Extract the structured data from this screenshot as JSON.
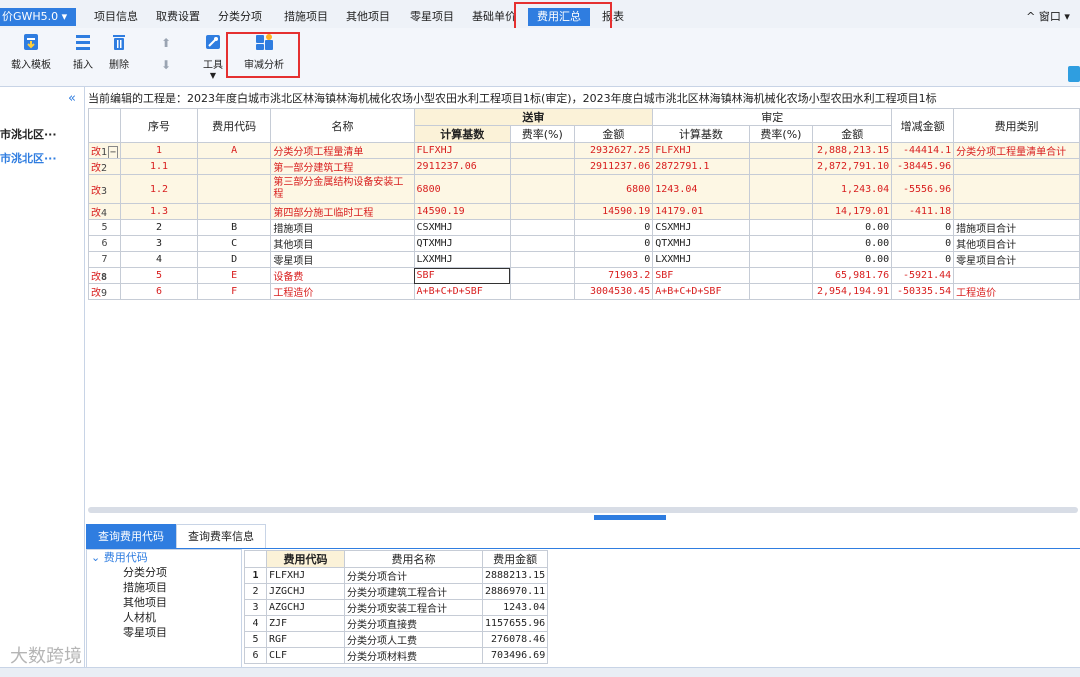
{
  "app": {
    "title": "价GWH5.0"
  },
  "menu": {
    "items": [
      "项目信息",
      "取费设置",
      "分类分项",
      "措施项目",
      "其他项目",
      "零星项目",
      "基础单价",
      "费用汇总",
      "报表"
    ],
    "active": "费用汇总",
    "window_label": "窗口"
  },
  "toolbar": {
    "load_template": "载入模板",
    "insert": "插入",
    "delete": "删除",
    "tools": "工具",
    "audit_analysis": "审减分析"
  },
  "left_panel": {
    "items": [
      "市洮北区···",
      "市洮北区···"
    ]
  },
  "project_info": "当前编辑的工程是：2023年度白城市洮北区林海镇林海机械化农场小型农田水利工程项目1标(审定)，2023年度白城市洮北区林海镇林海机械化农场小型农田水利工程项目1标",
  "grid": {
    "headers": {
      "seq": "序号",
      "code": "费用代码",
      "name": "名称",
      "submit": "送审",
      "approve": "审定",
      "base": "计算基数",
      "rate": "费率(%)",
      "amount": "金额",
      "diff": "增减金额",
      "category": "费用类别"
    },
    "rows": [
      {
        "mark": "改",
        "row": "1",
        "toggle": "−",
        "seq": "1",
        "code": "A",
        "name": "分类分项工程量清单",
        "s_base": "FLFXHJ",
        "s_rate": "",
        "s_amount": "2932627.25",
        "a_base": "FLFXHJ",
        "a_rate": "",
        "a_amount": "2,888,213.15",
        "diff": "-44414.1",
        "category": "分类分项工程量清单合计",
        "red": true
      },
      {
        "mark": "改",
        "row": "2",
        "seq": "1.1",
        "code": "",
        "name": "第一部分建筑工程",
        "s_base": "2911237.06",
        "s_rate": "",
        "s_amount": "2911237.06",
        "a_base": "2872791.1",
        "a_rate": "",
        "a_amount": "2,872,791.10",
        "diff": "-38445.96",
        "category": "",
        "red": true
      },
      {
        "mark": "改",
        "row": "3",
        "seq": "1.2",
        "code": "",
        "name": "第三部分金属结构设备安装工程",
        "s_base": "6800",
        "s_rate": "",
        "s_amount": "6800",
        "a_base": "1243.04",
        "a_rate": "",
        "a_amount": "1,243.04",
        "diff": "-5556.96",
        "category": "",
        "red": true
      },
      {
        "mark": "改",
        "row": "4",
        "seq": "1.3",
        "code": "",
        "name": "第四部分施工临时工程",
        "s_base": "14590.19",
        "s_rate": "",
        "s_amount": "14590.19",
        "a_base": "14179.01",
        "a_rate": "",
        "a_amount": "14,179.01",
        "diff": "-411.18",
        "category": "",
        "red": true
      },
      {
        "mark": "",
        "row": "5",
        "seq": "2",
        "code": "B",
        "name": "措施项目",
        "s_base": "CSXMHJ",
        "s_rate": "",
        "s_amount": "0",
        "a_base": "CSXMHJ",
        "a_rate": "",
        "a_amount": "0.00",
        "diff": "0",
        "category": "措施项目合计",
        "red": false
      },
      {
        "mark": "",
        "row": "6",
        "seq": "3",
        "code": "C",
        "name": "其他项目",
        "s_base": "QTXMHJ",
        "s_rate": "",
        "s_amount": "0",
        "a_base": "QTXMHJ",
        "a_rate": "",
        "a_amount": "0.00",
        "diff": "0",
        "category": "其他项目合计",
        "red": false
      },
      {
        "mark": "",
        "row": "7",
        "seq": "4",
        "code": "D",
        "name": "零星项目",
        "s_base": "LXXMHJ",
        "s_rate": "",
        "s_amount": "0",
        "a_base": "LXXMHJ",
        "a_rate": "",
        "a_amount": "0.00",
        "diff": "0",
        "category": "零星项目合计",
        "red": false
      },
      {
        "mark": "改",
        "row": "8",
        "seq": "5",
        "code": "E",
        "name": "设备费",
        "s_base": "SBF",
        "s_rate": "",
        "s_amount": "71903.2",
        "a_base": "SBF",
        "a_rate": "",
        "a_amount": "65,981.76",
        "diff": "-5921.44",
        "category": "",
        "red": true
      },
      {
        "mark": "改",
        "row": "9",
        "seq": "6",
        "code": "F",
        "name": "工程造价",
        "s_base": "A+B+C+D+SBF",
        "s_rate": "",
        "s_amount": "3004530.45",
        "a_base": "A+B+C+D+SBF",
        "a_rate": "",
        "a_amount": "2,954,194.91",
        "diff": "-50335.54",
        "category": "工程造价",
        "red": true
      }
    ]
  },
  "bottom": {
    "tabs": [
      "查询费用代码",
      "查询费率信息"
    ],
    "tree": {
      "root": "费用代码",
      "children": [
        "分类分项",
        "措施项目",
        "其他项目",
        "人材机",
        "零星项目"
      ]
    },
    "table": {
      "headers": [
        "费用代码",
        "费用名称",
        "费用金额"
      ],
      "rows": [
        [
          "1",
          "FLFXHJ",
          "分类分项合计",
          "2888213.15"
        ],
        [
          "2",
          "JZGCHJ",
          "分类分项建筑工程合计",
          "2886970.11"
        ],
        [
          "3",
          "AZGCHJ",
          "分类分项安装工程合计",
          "1243.04"
        ],
        [
          "4",
          "ZJF",
          "分类分项直接费",
          "1157655.96"
        ],
        [
          "5",
          "RGF",
          "分类分项人工费",
          "276078.46"
        ],
        [
          "6",
          "CLF",
          "分类分项材料费",
          "703496.69"
        ]
      ]
    }
  },
  "watermark": "大数跨境"
}
